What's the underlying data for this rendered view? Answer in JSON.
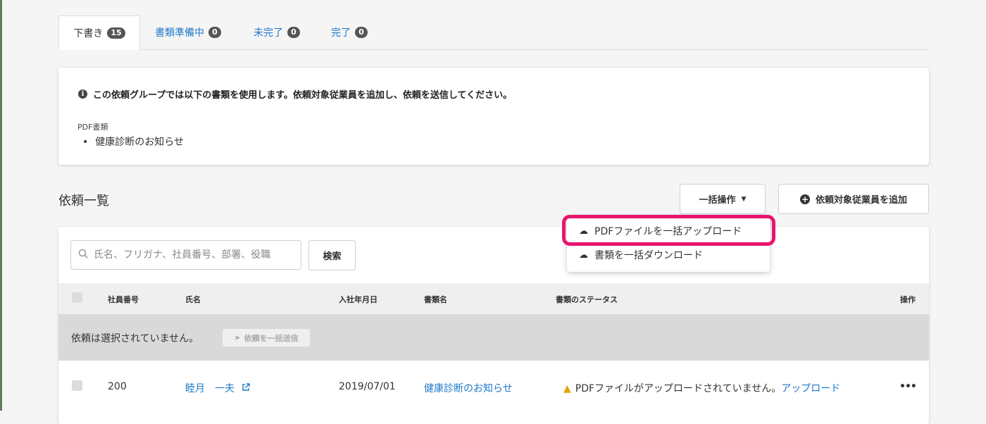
{
  "tabs": [
    {
      "label": "下書き",
      "count": "15"
    },
    {
      "label": "書類準備中",
      "count": "0"
    },
    {
      "label": "未完了",
      "count": "0"
    },
    {
      "label": "完了",
      "count": "0"
    }
  ],
  "info": {
    "message": "この依頼グループでは以下の書類を使用します。依頼対象従業員を追加し、依頼を送信してください。",
    "pdf_label": "PDF書類",
    "documents": [
      "健康診断のお知らせ"
    ]
  },
  "list": {
    "title": "依頼一覧",
    "bulk_button": "一括操作",
    "add_button": "依頼対象従業員を追加",
    "search_placeholder": "氏名、フリガナ、社員番号、部署、役職",
    "search_button": "検索"
  },
  "table": {
    "headers": [
      "社員番号",
      "氏名",
      "入社年月日",
      "書類名",
      "書類のステータス",
      "操作"
    ],
    "empty_message": "依頼は選択されていません。",
    "send_button": "依頼を一括送信",
    "rows": [
      {
        "employee_no": "200",
        "name": "睦月　一夫",
        "hire_date": "2019/07/01",
        "document": "健康診断のお知らせ",
        "status": "PDFファイルがアップロードされていません。",
        "status_link": "アップロード"
      }
    ]
  },
  "dropdown": {
    "items": [
      "PDFファイルを一括アップロード",
      "書類を一括ダウンロード"
    ]
  },
  "colors": {
    "link": "#1f78c9",
    "highlight": "#e8156c",
    "warning": "#e8a100"
  }
}
